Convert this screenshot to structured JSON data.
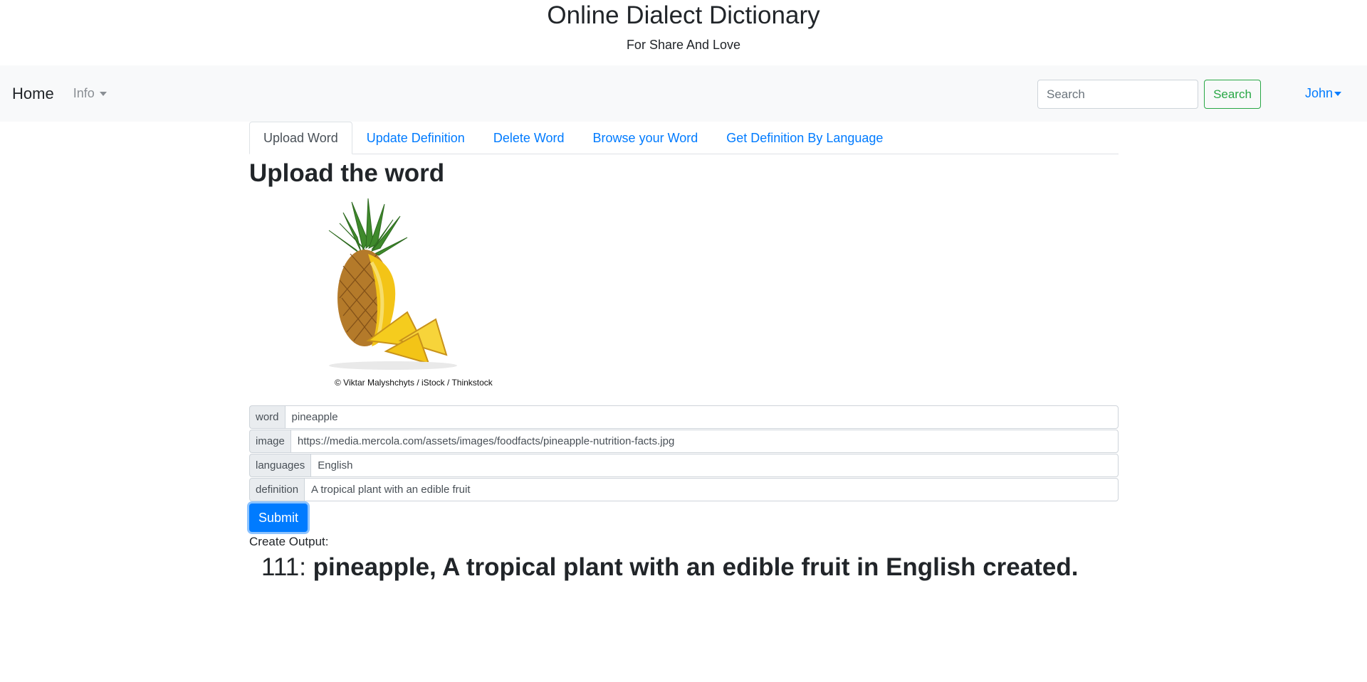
{
  "header": {
    "title": "Online Dialect Dictionary",
    "subtitle": "For Share And Love"
  },
  "navbar": {
    "brand": "Home",
    "info_label": "Info",
    "search_placeholder": "Search",
    "search_button": "Search",
    "user_label": "John"
  },
  "tabs": [
    {
      "label": "Upload Word",
      "active": true
    },
    {
      "label": "Update Definition",
      "active": false
    },
    {
      "label": "Delete Word",
      "active": false
    },
    {
      "label": "Browse your Word",
      "active": false
    },
    {
      "label": "Get Definition By Language",
      "active": false
    }
  ],
  "main": {
    "heading": "Upload the word",
    "image_credit": "©  Viktar Malyshchyts / iStock / Thinkstock",
    "form": {
      "word": {
        "label": "word",
        "value": "pineapple"
      },
      "image": {
        "label": "image",
        "value": "https://media.mercola.com/assets/images/foodfacts/pineapple-nutrition-facts.jpg"
      },
      "languages": {
        "label": "languages",
        "value": "English"
      },
      "definition": {
        "label": "definition",
        "value": "A tropical plant with an edible fruit"
      },
      "submit_label": "Submit"
    },
    "output": {
      "label": "Create Output:",
      "id": "111:",
      "text": "pineapple, A tropical plant with an edible fruit in English created."
    }
  },
  "colors": {
    "link": "#007bff",
    "success": "#28a745",
    "navbar_bg": "#f8f9fa"
  }
}
